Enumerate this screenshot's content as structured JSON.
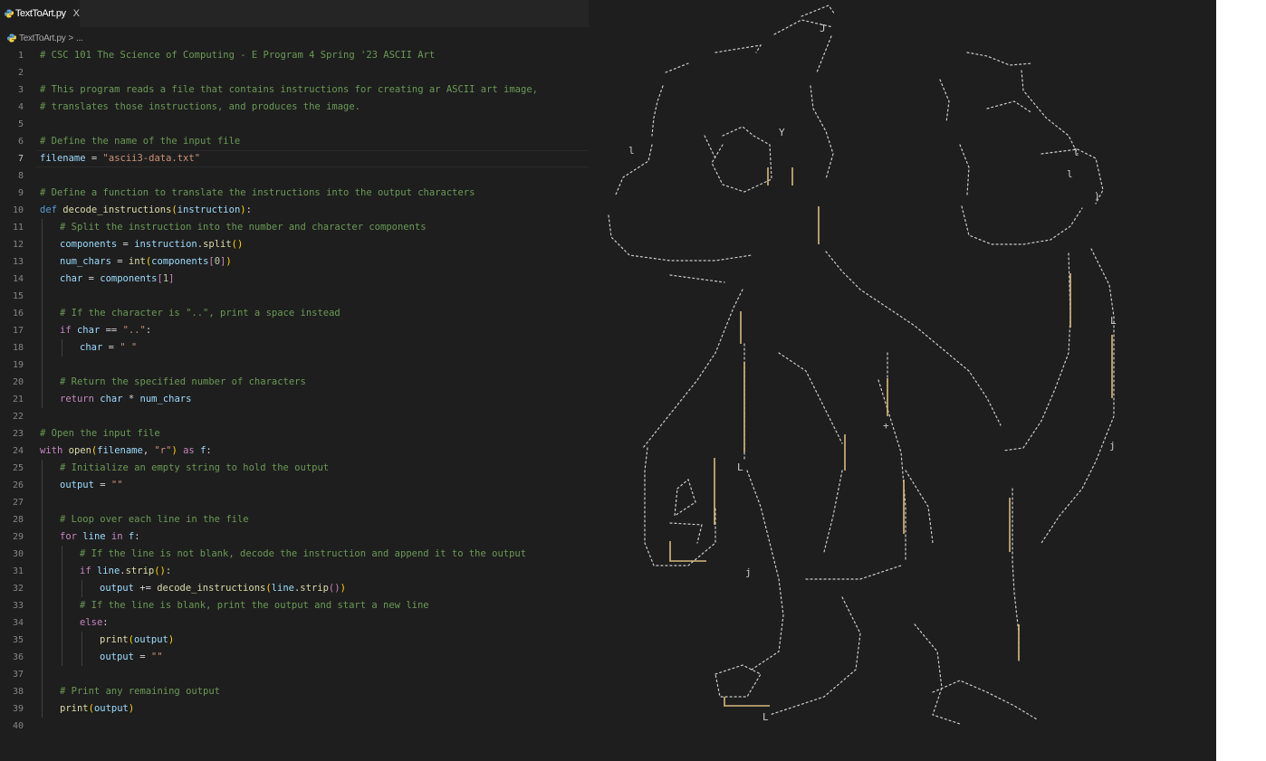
{
  "tab": {
    "label": "TextToArt.py",
    "close": "X",
    "icon": "python-file-icon"
  },
  "breadcrumb": {
    "file": "TextToArt.py",
    "sep": ">",
    "more": "..."
  },
  "code": {
    "lines": [
      {
        "n": "1",
        "indent": 0,
        "tokens": [
          [
            "c",
            "# CSC 101 The Science of Computing - E Program 4 Spring '23 ASCII Art"
          ]
        ]
      },
      {
        "n": "2",
        "indent": 0,
        "tokens": []
      },
      {
        "n": "3",
        "indent": 0,
        "tokens": [
          [
            "c",
            "# This program reads a file that contains instructions for creating ar ASCII art image,"
          ]
        ]
      },
      {
        "n": "4",
        "indent": 0,
        "tokens": [
          [
            "c",
            "# translates those instructions, and produces the image."
          ]
        ]
      },
      {
        "n": "5",
        "indent": 0,
        "tokens": []
      },
      {
        "n": "6",
        "indent": 0,
        "tokens": [
          [
            "c",
            "# Define the name of the input file"
          ]
        ]
      },
      {
        "n": "7",
        "indent": 0,
        "active": true,
        "tokens": [
          [
            "v",
            "filename"
          ],
          [
            "p",
            " = "
          ],
          [
            "s",
            "\"ascii3-data.txt\""
          ]
        ]
      },
      {
        "n": "8",
        "indent": 0,
        "tokens": []
      },
      {
        "n": "9",
        "indent": 0,
        "tokens": [
          [
            "c",
            "# Define a function to translate the instructions into the output characters"
          ]
        ]
      },
      {
        "n": "10",
        "indent": 0,
        "tokens": [
          [
            "k",
            "def"
          ],
          [
            "p",
            " "
          ],
          [
            "f",
            "decode_instructions"
          ],
          [
            "b",
            "("
          ],
          [
            "v",
            "instruction"
          ],
          [
            "b",
            ")"
          ],
          [
            "p",
            ":"
          ]
        ]
      },
      {
        "n": "11",
        "indent": 1,
        "tokens": [
          [
            "c",
            "# Split the instruction into the number and character components"
          ]
        ]
      },
      {
        "n": "12",
        "indent": 1,
        "tokens": [
          [
            "v",
            "components"
          ],
          [
            "p",
            " = "
          ],
          [
            "v",
            "instruction"
          ],
          [
            "p",
            "."
          ],
          [
            "f",
            "split"
          ],
          [
            "b",
            "()"
          ]
        ]
      },
      {
        "n": "13",
        "indent": 1,
        "tokens": [
          [
            "v",
            "num_chars"
          ],
          [
            "p",
            " = "
          ],
          [
            "f",
            "int"
          ],
          [
            "b",
            "("
          ],
          [
            "v",
            "components"
          ],
          [
            "kc",
            "["
          ],
          [
            "n",
            "0"
          ],
          [
            "kc",
            "]"
          ],
          [
            "b",
            ")"
          ]
        ]
      },
      {
        "n": "14",
        "indent": 1,
        "tokens": [
          [
            "v",
            "char"
          ],
          [
            "p",
            " = "
          ],
          [
            "v",
            "components"
          ],
          [
            "kc",
            "["
          ],
          [
            "n",
            "1"
          ],
          [
            "kc",
            "]"
          ]
        ]
      },
      {
        "n": "15",
        "indent": 1,
        "tokens": []
      },
      {
        "n": "16",
        "indent": 1,
        "tokens": [
          [
            "c",
            "# If the character is \"..\", print a space instead"
          ]
        ]
      },
      {
        "n": "17",
        "indent": 1,
        "tokens": [
          [
            "kc",
            "if"
          ],
          [
            "p",
            " "
          ],
          [
            "v",
            "char"
          ],
          [
            "p",
            " == "
          ],
          [
            "s",
            "\"..\""
          ],
          [
            "p",
            ":"
          ]
        ]
      },
      {
        "n": "18",
        "indent": 2,
        "tokens": [
          [
            "v",
            "char"
          ],
          [
            "p",
            " = "
          ],
          [
            "s",
            "\" \""
          ]
        ]
      },
      {
        "n": "19",
        "indent": 1,
        "tokens": []
      },
      {
        "n": "20",
        "indent": 1,
        "tokens": [
          [
            "c",
            "# Return the specified number of characters"
          ]
        ]
      },
      {
        "n": "21",
        "indent": 1,
        "tokens": [
          [
            "kc",
            "return"
          ],
          [
            "p",
            " "
          ],
          [
            "v",
            "char"
          ],
          [
            "p",
            " * "
          ],
          [
            "v",
            "num_chars"
          ]
        ]
      },
      {
        "n": "22",
        "indent": 0,
        "tokens": []
      },
      {
        "n": "23",
        "indent": 0,
        "tokens": [
          [
            "c",
            "# Open the input file"
          ]
        ]
      },
      {
        "n": "24",
        "indent": 0,
        "tokens": [
          [
            "kc",
            "with"
          ],
          [
            "p",
            " "
          ],
          [
            "f",
            "open"
          ],
          [
            "b",
            "("
          ],
          [
            "v",
            "filename"
          ],
          [
            "p",
            ", "
          ],
          [
            "s",
            "\"r\""
          ],
          [
            "b",
            ")"
          ],
          [
            "p",
            " "
          ],
          [
            "kc",
            "as"
          ],
          [
            "p",
            " "
          ],
          [
            "v",
            "f"
          ],
          [
            "p",
            ":"
          ]
        ]
      },
      {
        "n": "25",
        "indent": 1,
        "tokens": [
          [
            "c",
            "# Initialize an empty string to hold the output"
          ]
        ]
      },
      {
        "n": "26",
        "indent": 1,
        "tokens": [
          [
            "v",
            "output"
          ],
          [
            "p",
            " = "
          ],
          [
            "s",
            "\"\""
          ]
        ]
      },
      {
        "n": "27",
        "indent": 1,
        "tokens": []
      },
      {
        "n": "28",
        "indent": 1,
        "tokens": [
          [
            "c",
            "# Loop over each line in the file"
          ]
        ]
      },
      {
        "n": "29",
        "indent": 1,
        "tokens": [
          [
            "kc",
            "for"
          ],
          [
            "p",
            " "
          ],
          [
            "v",
            "line"
          ],
          [
            "p",
            " "
          ],
          [
            "kc",
            "in"
          ],
          [
            "p",
            " "
          ],
          [
            "v",
            "f"
          ],
          [
            "p",
            ":"
          ]
        ]
      },
      {
        "n": "30",
        "indent": 2,
        "tokens": [
          [
            "c",
            "# If the line is not blank, decode the instruction and append it to the output"
          ]
        ]
      },
      {
        "n": "31",
        "indent": 2,
        "tokens": [
          [
            "kc",
            "if"
          ],
          [
            "p",
            " "
          ],
          [
            "v",
            "line"
          ],
          [
            "p",
            "."
          ],
          [
            "f",
            "strip"
          ],
          [
            "b",
            "()"
          ],
          [
            "p",
            ":"
          ]
        ]
      },
      {
        "n": "32",
        "indent": 3,
        "tokens": [
          [
            "v",
            "output"
          ],
          [
            "p",
            " += "
          ],
          [
            "f",
            "decode_instructions"
          ],
          [
            "b",
            "("
          ],
          [
            "v",
            "line"
          ],
          [
            "p",
            "."
          ],
          [
            "f",
            "strip"
          ],
          [
            "kc",
            "()"
          ],
          [
            "b",
            ")"
          ]
        ]
      },
      {
        "n": "33",
        "indent": 2,
        "tokens": [
          [
            "c",
            "# If the line is blank, print the output and start a new line"
          ]
        ]
      },
      {
        "n": "34",
        "indent": 2,
        "tokens": [
          [
            "kc",
            "else"
          ],
          [
            "p",
            ":"
          ]
        ]
      },
      {
        "n": "35",
        "indent": 3,
        "tokens": [
          [
            "f",
            "print"
          ],
          [
            "b",
            "("
          ],
          [
            "v",
            "output"
          ],
          [
            "b",
            ")"
          ]
        ]
      },
      {
        "n": "36",
        "indent": 3,
        "tokens": [
          [
            "v",
            "output"
          ],
          [
            "p",
            " = "
          ],
          [
            "s",
            "\"\""
          ]
        ]
      },
      {
        "n": "37",
        "indent": 1,
        "tokens": []
      },
      {
        "n": "38",
        "indent": 1,
        "tokens": [
          [
            "c",
            "# Print any remaining output"
          ]
        ]
      },
      {
        "n": "39",
        "indent": 1,
        "tokens": [
          [
            "f",
            "print"
          ],
          [
            "b",
            "("
          ],
          [
            "v",
            "output"
          ],
          [
            "b",
            ")"
          ]
        ]
      },
      {
        "n": "40",
        "indent": 0,
        "tokens": []
      }
    ]
  },
  "colors": {
    "background": "#1e1e1e",
    "comment": "#6a9955",
    "keyword": "#569cd6",
    "control": "#c586c0",
    "string": "#ce9178",
    "function": "#dcdcaa",
    "variable": "#9cdcfe",
    "number": "#b5cea8",
    "bracket": "#ffd700",
    "art_bars": "#d7ba7d",
    "art_text": "#cccccc"
  }
}
